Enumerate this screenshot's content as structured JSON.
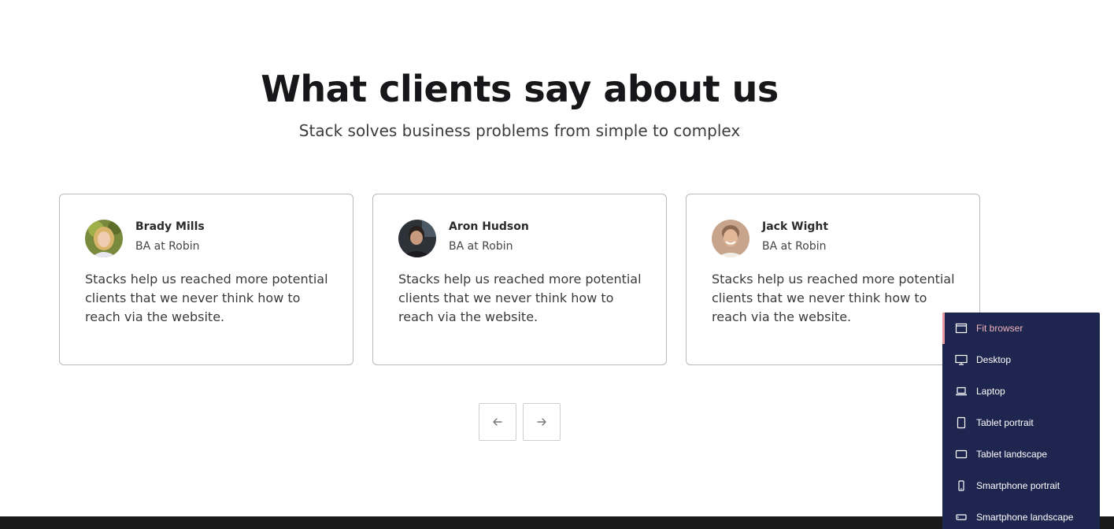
{
  "section": {
    "title": "What clients say about us",
    "subtitle": "Stack solves business problems from simple to complex"
  },
  "testimonials": [
    {
      "name": "Brady Mills",
      "role": "BA at Robin",
      "quote": "Stacks help us reached more potential clients that we never think how to reach via the website.",
      "avatar": "avatar-blonde-woman"
    },
    {
      "name": "Aron Hudson",
      "role": "BA at Robin",
      "quote": "Stacks help us reached more potential clients that we never think how to reach via the website.",
      "avatar": "avatar-dark-haired-man"
    },
    {
      "name": "Jack Wight",
      "role": "BA at Robin",
      "quote": "Stacks help us reached more potential clients that we never think how to reach via the website.",
      "avatar": "avatar-smiling-man"
    }
  ],
  "carousel": {
    "prev_icon": "arrow-left-icon",
    "next_icon": "arrow-right-icon"
  },
  "device_menu": {
    "accent_color": "#e79aa0",
    "background_color": "#1e2650",
    "items": [
      {
        "label": "Fit browser",
        "icon": "browser-window-icon",
        "active": true
      },
      {
        "label": "Desktop",
        "icon": "desktop-icon",
        "active": false
      },
      {
        "label": "Laptop",
        "icon": "laptop-icon",
        "active": false
      },
      {
        "label": "Tablet portrait",
        "icon": "tablet-portrait-icon",
        "active": false
      },
      {
        "label": "Tablet landscape",
        "icon": "tablet-landscape-icon",
        "active": false
      },
      {
        "label": "Smartphone portrait",
        "icon": "smartphone-portrait-icon",
        "active": false
      },
      {
        "label": "Smartphone landscape",
        "icon": "smartphone-landscape-icon",
        "active": false
      }
    ]
  }
}
